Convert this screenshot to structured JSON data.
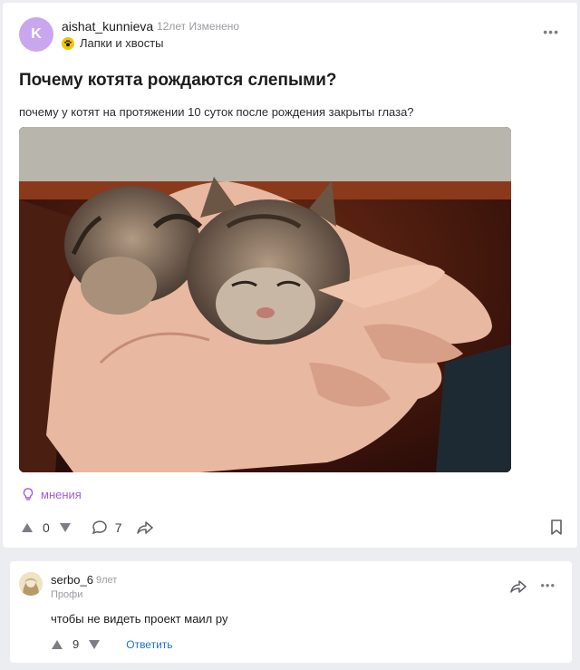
{
  "post": {
    "avatar_letter": "K",
    "author": "aishat_kunnieva",
    "meta": "12лет Изменено",
    "category": "Лапки и хвосты",
    "title": "Почему котята рождаются слепыми?",
    "question": "почему у котят на протяжении 10 суток после рождения закрыты глаза?",
    "opinion_label": "мнения",
    "votes": "0",
    "comments_count": "7",
    "colors": {
      "avatar": "#c9a7ef",
      "opinion": "#a55bdc",
      "link": "#1a6fd6"
    }
  },
  "comment": {
    "author": "serbo_6",
    "time": "9лет",
    "rank": "Профи",
    "text": "чтобы не видеть проект маил ру",
    "votes": "9",
    "reply_label": "Ответить"
  }
}
